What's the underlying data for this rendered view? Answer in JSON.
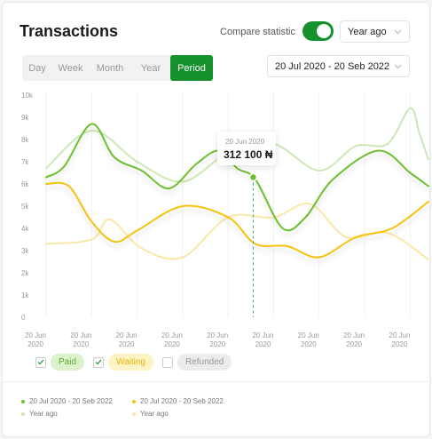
{
  "header": {
    "title": "Transactions",
    "compare_label": "Compare statistic",
    "compare_enabled": true,
    "period_select": "Year ago"
  },
  "tabs": [
    {
      "label": "Day",
      "active": false
    },
    {
      "label": "Week",
      "active": false
    },
    {
      "label": "Month",
      "active": false
    },
    {
      "label": "Year",
      "active": false
    },
    {
      "label": "Period",
      "active": true
    }
  ],
  "date_range": "20 Jul 2020 - 20 Seb 2022",
  "tooltip": {
    "date": "20 Jun 2020",
    "value": "312 100 ₦"
  },
  "colors": {
    "accent": "#16912d",
    "paid": "#6cbf2d",
    "paid_prev": "#cde8b4",
    "waiting": "#f5c20f",
    "waiting_prev": "#fbe8a8",
    "refunded_pill": "#ececec"
  },
  "legend": [
    {
      "label": "Paid",
      "checked": true,
      "bg": "#dcf2cd",
      "color": "#5ba82b"
    },
    {
      "label": "Waiting",
      "checked": true,
      "bg": "#fdf3c4",
      "color": "#e3b510"
    },
    {
      "label": "Refunded",
      "checked": false,
      "bg": "#ececec",
      "color": "#999999"
    }
  ],
  "footer": {
    "paid_current": "20 Jul 2020 - 20 Seb 2022",
    "paid_previous": "Year ago",
    "waiting_current": "20 Jul 2020 - 20 Seb 2022",
    "waiting_previous": "Year ago"
  },
  "chart_data": {
    "type": "line",
    "y_ticks": [
      "0",
      "1k",
      "2k",
      "3k",
      "4k",
      "5k",
      "6k",
      "7k",
      "8k",
      "9k",
      "10k"
    ],
    "ylim": [
      0,
      10000
    ],
    "x_ticks": [
      [
        "20 Jun",
        "2020"
      ],
      [
        "20 Jun",
        "2020"
      ],
      [
        "20 Jun",
        "2020"
      ],
      [
        "20 Jun",
        "2020"
      ],
      [
        "20 Jun",
        "2020"
      ],
      [
        "20 Jun",
        "2020"
      ],
      [
        "20 Jun",
        "2020"
      ],
      [
        "20 Jun",
        "2020"
      ],
      [
        "20 Jun",
        "2020"
      ]
    ],
    "series": [
      {
        "name": "Paid 20 Jul 2020 - 20 Seb 2022",
        "role": "paid",
        "points": [
          [
            0,
            6300
          ],
          [
            0.4,
            6800
          ],
          [
            1,
            8700
          ],
          [
            1.5,
            7200
          ],
          [
            2.1,
            6600
          ],
          [
            2.7,
            5800
          ],
          [
            3.3,
            6900
          ],
          [
            3.8,
            7500
          ],
          [
            4.2,
            6700
          ],
          [
            4.6,
            6200
          ],
          [
            5.2,
            4000
          ],
          [
            5.7,
            4500
          ],
          [
            6.3,
            6200
          ],
          [
            7.3,
            7500
          ],
          [
            8,
            6500
          ],
          [
            8.4,
            5900
          ]
        ]
      },
      {
        "name": "Paid Year ago",
        "role": "paid_prev",
        "points": [
          [
            0,
            6700
          ],
          [
            1,
            8400
          ],
          [
            2,
            7000
          ],
          [
            3,
            6100
          ],
          [
            4,
            7400
          ],
          [
            5,
            7800
          ],
          [
            6,
            6600
          ],
          [
            6.8,
            7700
          ],
          [
            7.5,
            7800
          ],
          [
            8,
            9400
          ],
          [
            8.2,
            8300
          ],
          [
            8.4,
            7100
          ]
        ]
      },
      {
        "name": "Waiting 20 Jul 2020 - 20 Seb 2022",
        "role": "waiting",
        "points": [
          [
            0,
            6000
          ],
          [
            0.5,
            5900
          ],
          [
            1,
            4300
          ],
          [
            1.5,
            3400
          ],
          [
            2,
            3900
          ],
          [
            3,
            5000
          ],
          [
            4,
            4500
          ],
          [
            4.6,
            3300
          ],
          [
            5.3,
            3200
          ],
          [
            6,
            2700
          ],
          [
            6.8,
            3600
          ],
          [
            7.6,
            4000
          ],
          [
            8.4,
            5200
          ]
        ]
      },
      {
        "name": "Waiting Year ago",
        "role": "waiting_prev",
        "points": [
          [
            0,
            3300
          ],
          [
            1,
            3500
          ],
          [
            1.4,
            4400
          ],
          [
            2.1,
            3100
          ],
          [
            3,
            2700
          ],
          [
            4,
            4500
          ],
          [
            5,
            4500
          ],
          [
            5.8,
            5100
          ],
          [
            6.6,
            3600
          ],
          [
            7.5,
            3800
          ],
          [
            8.4,
            2600
          ]
        ]
      }
    ],
    "highlight": {
      "x": 4.55,
      "y": 6300,
      "label": "312 100 ₦"
    },
    "grid": true
  }
}
